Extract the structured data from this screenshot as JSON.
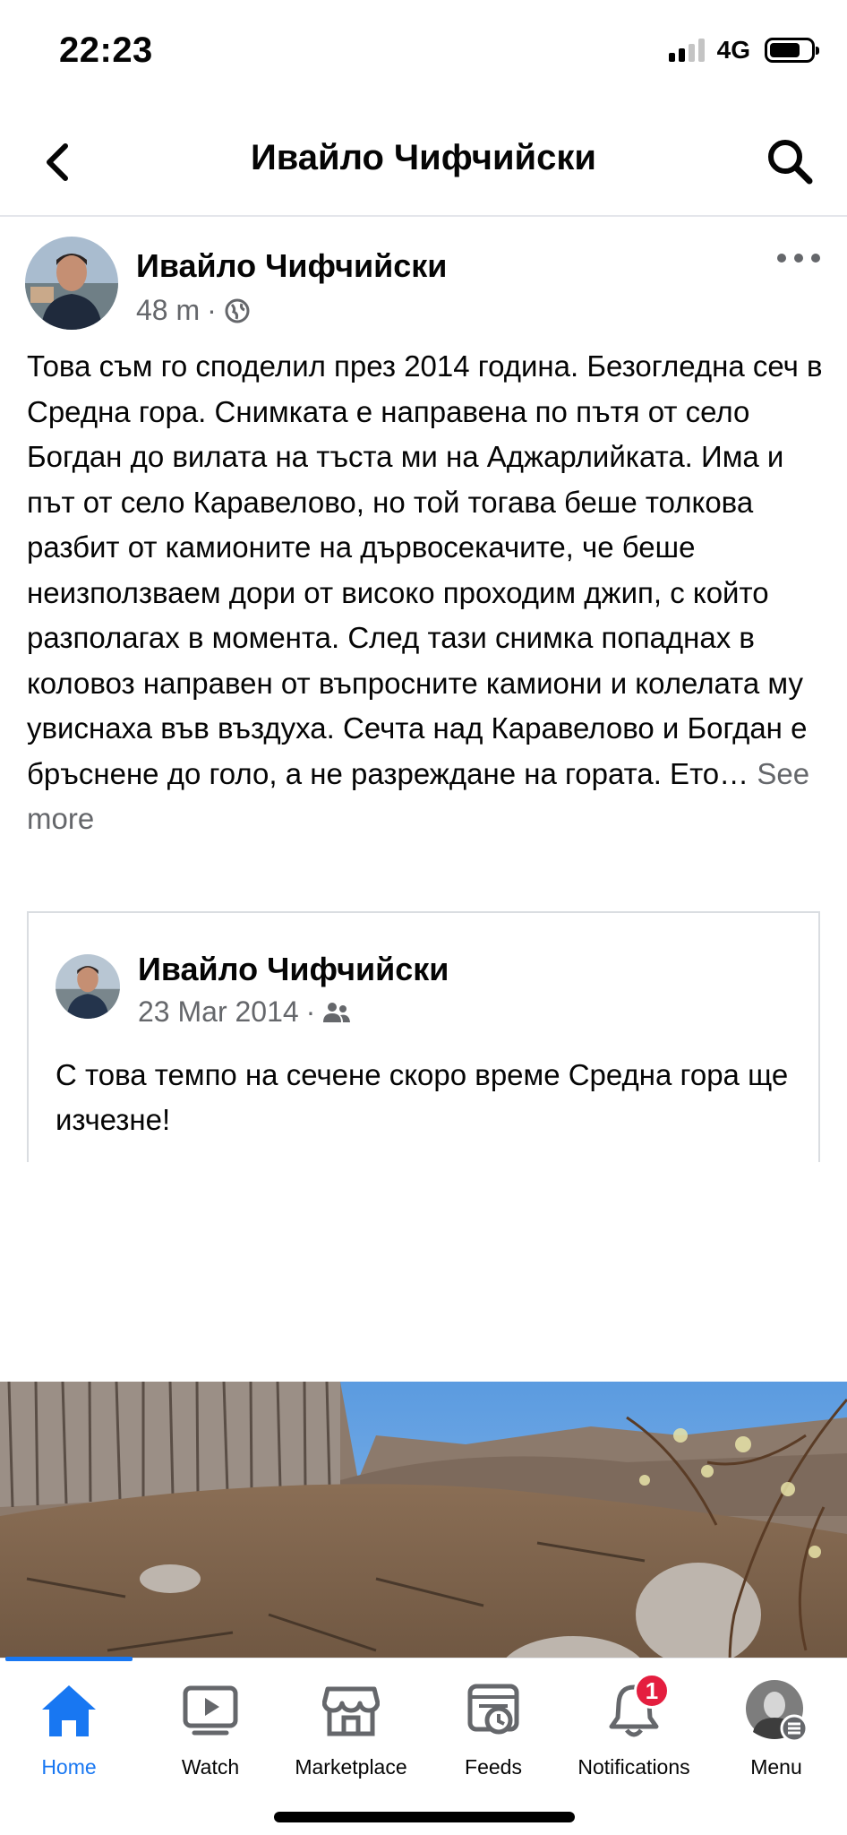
{
  "status_bar": {
    "time": "22:23",
    "network": "4G"
  },
  "header": {
    "title": "Ивайло Чифчийски"
  },
  "post": {
    "author": "Ивайло Чифчийски",
    "time": "48 m",
    "separator": "·",
    "text": "Това съм го споделил през 2014 година. Безогледна сеч в Средна гора. Снимката е направена по пътя от село Богдан до вилата на тъста ми на Аджарлийката. Има и път от село Каравелово, но той тогава беше толкова разбит от камионите на дървосекачите, че беше неизползваем дори от високо проходим джип, с който разполагах в момента. След тази снимка попаднах в коловоз направен от въпросните камиони и колелата му увиснаха във въздуха. Сечта над Каравелово и Богдан е  бръснене до голо, а не разреждане на гората. Ето…",
    "see_more": "See more",
    "privacy_icon": "globe-icon"
  },
  "shared_post": {
    "author": "Ивайло Чифчийски",
    "date": "23 Mar 2014",
    "separator": "·",
    "privacy_icon": "friends-icon",
    "text": "С това темпо на сечене скоро време Средна гора ще изчезне!"
  },
  "tabs": [
    {
      "label": "Home",
      "icon": "home-icon",
      "active": true
    },
    {
      "label": "Watch",
      "icon": "watch-icon",
      "active": false
    },
    {
      "label": "Marketplace",
      "icon": "marketplace-icon",
      "active": false
    },
    {
      "label": "Feeds",
      "icon": "feeds-icon",
      "active": false
    },
    {
      "label": "Notifications",
      "icon": "bell-icon",
      "active": false,
      "badge": "1"
    },
    {
      "label": "Menu",
      "icon": "profile-menu-icon",
      "active": false
    }
  ],
  "colors": {
    "accent": "#1877f2",
    "badge": "#e41e3f",
    "secondary_text": "#65676b"
  }
}
